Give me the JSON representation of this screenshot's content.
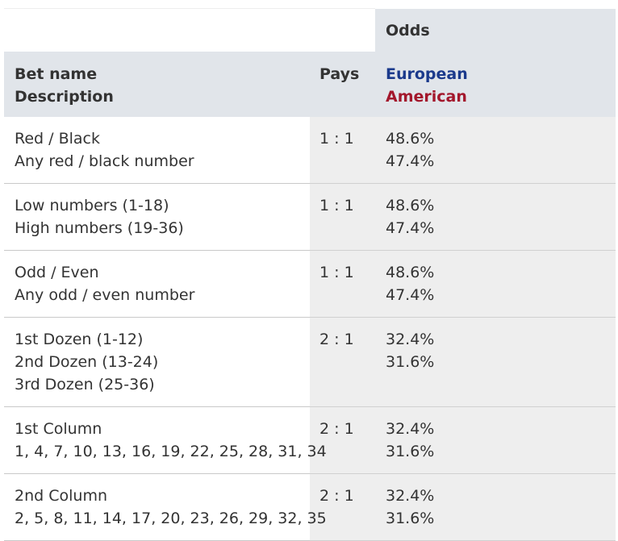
{
  "table": {
    "odds_title": "Odds",
    "headers": {
      "bet_name": "Bet name",
      "description": "Description",
      "pays": "Pays",
      "european": "European",
      "american": "American"
    },
    "rows": [
      {
        "name_lines": [
          "Red / Black",
          "Any red / black number"
        ],
        "pays": "1 : 1",
        "european": "48.6%",
        "american": "47.4%"
      },
      {
        "name_lines": [
          "Low numbers (1-18)",
          "High numbers (19-36)"
        ],
        "pays": "1 : 1",
        "european": "48.6%",
        "american": "47.4%"
      },
      {
        "name_lines": [
          "Odd / Even",
          "Any odd / even number"
        ],
        "pays": "1 : 1",
        "european": "48.6%",
        "american": "47.4%"
      },
      {
        "name_lines": [
          "1st Dozen (1-12)",
          "2nd Dozen (13-24)",
          "3rd Dozen (25-36)"
        ],
        "pays": "2 : 1",
        "european": "32.4%",
        "american": "31.6%"
      },
      {
        "name_lines": [
          "1st Column",
          "1, 4, 7, 10, 13, 16, 19, 22, 25, 28, 31, 34"
        ],
        "pays": "2 : 1",
        "european": "32.4%",
        "american": "31.6%"
      },
      {
        "name_lines": [
          "2nd Column",
          "2, 5, 8, 11, 14, 17, 20, 23, 26, 29, 32, 35"
        ],
        "pays": "2 : 1",
        "european": "32.4%",
        "american": "31.6%"
      }
    ]
  },
  "colors": {
    "european": "#1b3a8c",
    "american": "#a3172c",
    "header_bg": "#e1e5ea",
    "shaded_cell_bg": "#eeeeee"
  }
}
